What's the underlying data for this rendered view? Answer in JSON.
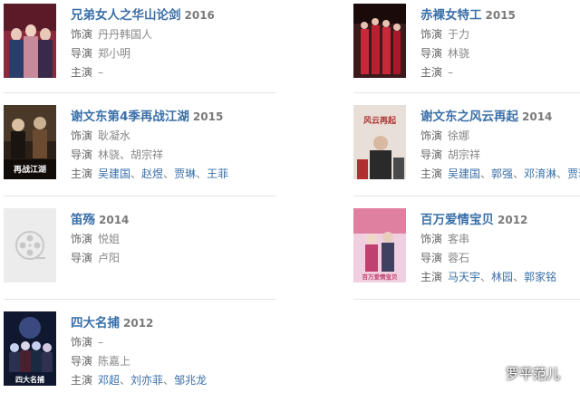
{
  "labels": {
    "role": "饰演",
    "director": "导演",
    "cast": "主演"
  },
  "sep": "、",
  "entries": [
    {
      "title": "兄弟女人之华山论剑",
      "year": "2016",
      "role": "丹丹韩国人",
      "director": "郑小明",
      "cast": "–",
      "cast_links": []
    },
    {
      "title": "赤裸女特工",
      "year": "2015",
      "role": "于力",
      "director": "林骁",
      "cast": "–",
      "cast_links": []
    },
    {
      "title": "谢文东第4季再战江湖",
      "year": "2015",
      "role": "耿凝水",
      "director": "林骁、胡宗祥",
      "cast_links": [
        "吴建国",
        "赵煜",
        "贾琳",
        "王菲"
      ]
    },
    {
      "title": "谢文东之风云再起",
      "year": "2014",
      "role": "徐娜",
      "director": "胡宗祥",
      "cast_links": [
        "吴建国",
        "郭强",
        "邓淯淋",
        "贾琳"
      ]
    },
    {
      "title": "笛殇",
      "year": "2014",
      "role": "悦姐",
      "director": "卢阳"
    },
    {
      "title": "百万爱情宝贝",
      "year": "2012",
      "role": "客串",
      "director": "蓉石",
      "cast_links": [
        "马天宇",
        "林园",
        "郭家铭"
      ]
    },
    {
      "title": "四大名捕",
      "year": "2012",
      "role": "–",
      "director": "陈嘉上",
      "cast_links": [
        "邓超",
        "刘亦菲",
        "邹兆龙"
      ]
    }
  ],
  "posters": {
    "p1": {
      "colors": [
        "#8a2a3a",
        "#2b3d6b",
        "#c78a9a"
      ]
    },
    "p2": {
      "colors": [
        "#3a1a1a",
        "#c8283a",
        "#e8c0b0"
      ]
    },
    "p3": {
      "colors": [
        "#2a2018",
        "#6a4a30",
        "#d8c0a0"
      ],
      "text": "再战江湖"
    },
    "p4": {
      "colors": [
        "#e8e0d8",
        "#b03030",
        "#2a2a2a"
      ],
      "text": "风云再起"
    },
    "p6": {
      "colors": [
        "#e080a0",
        "#c04070",
        "#f0d0e0"
      ],
      "text": "百万爱情宝贝"
    },
    "p7": {
      "colors": [
        "#101830",
        "#3a4a80",
        "#c8d0f0"
      ],
      "text": "四大名捕"
    }
  },
  "placeholder_icon": "film-reel-icon",
  "watermark": {
    "text": "罗平范儿",
    "icon": "wechat-icon"
  }
}
